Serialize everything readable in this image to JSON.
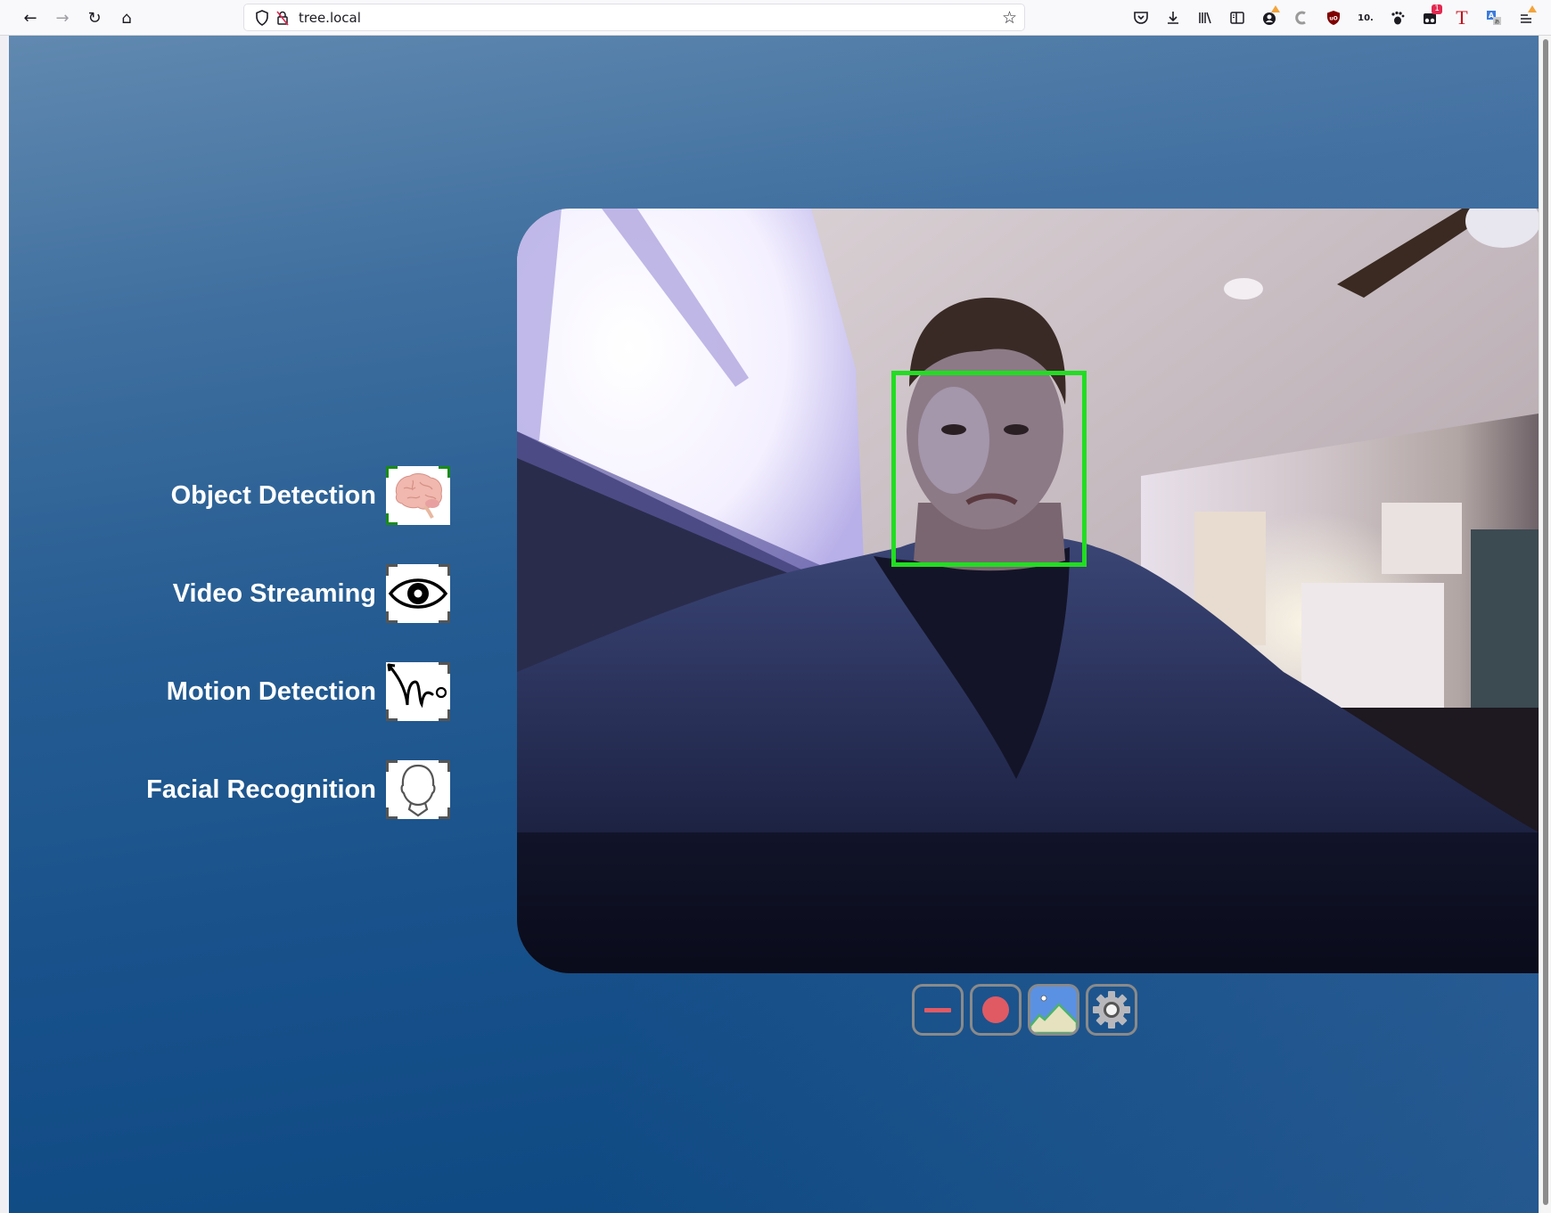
{
  "browser": {
    "nav": {
      "back_icon": "arrow-left-icon",
      "forward_icon": "arrow-right-icon",
      "reload_icon": "reload-icon",
      "home_icon": "home-icon"
    },
    "url": "tree.local",
    "toolbar_icons": [
      {
        "name": "pocket-icon",
        "glyph": "⛉"
      },
      {
        "name": "download-icon",
        "glyph": "⤓"
      },
      {
        "name": "library-icon",
        "glyph": "|||\\"
      },
      {
        "name": "sidebar-icon",
        "glyph": "◫"
      },
      {
        "name": "account-icon",
        "glyph": "●"
      },
      {
        "name": "extension-magnet-icon",
        "glyph": "C"
      },
      {
        "name": "ublock-icon",
        "glyph": "uO"
      },
      {
        "name": "extension-10-icon",
        "glyph": "10."
      },
      {
        "name": "extension-footprint-icon",
        "glyph": "❦"
      },
      {
        "name": "extension-glasses-icon",
        "glyph": "◙",
        "badge": "1"
      },
      {
        "name": "extension-t-icon",
        "glyph": "T"
      },
      {
        "name": "translate-icon",
        "glyph": "A"
      },
      {
        "name": "menu-icon",
        "glyph": "≡"
      }
    ]
  },
  "features": [
    {
      "label": "Object Detection",
      "icon": "brain-icon",
      "active": true
    },
    {
      "label": "Video Streaming",
      "icon": "eye-icon",
      "active": false
    },
    {
      "label": "Motion Detection",
      "icon": "motion-icon",
      "active": false
    },
    {
      "label": "Facial Recognition",
      "icon": "head-icon",
      "active": false
    }
  ],
  "video": {
    "description": "live webcam feed with face detection box",
    "detection_box_color": "#22dd22"
  },
  "controls": [
    {
      "name": "minimize-button",
      "icon": "minus-icon"
    },
    {
      "name": "record-button",
      "icon": "record-icon"
    },
    {
      "name": "snapshot-button",
      "icon": "image-icon"
    },
    {
      "name": "settings-button",
      "icon": "gear-icon"
    }
  ],
  "colors": {
    "record_red": "#e05a64",
    "active_corner": "#1a8a1a"
  }
}
